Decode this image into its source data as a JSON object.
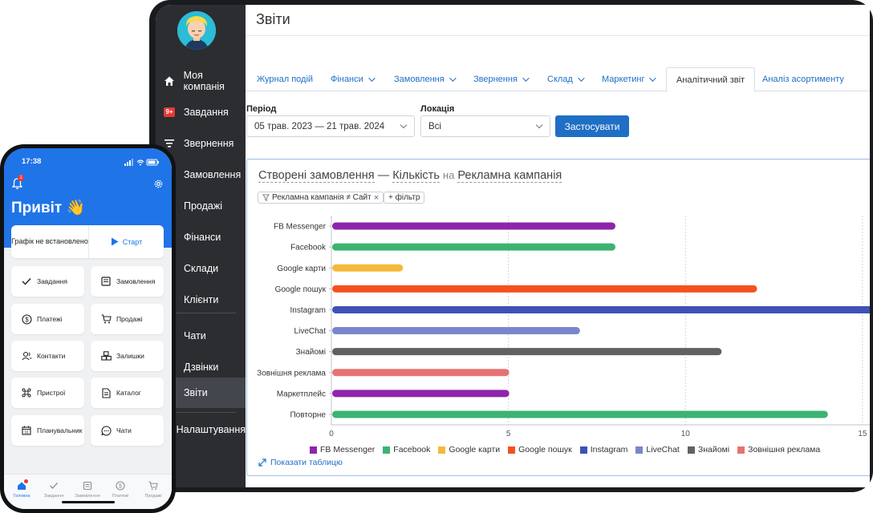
{
  "tablet": {
    "sidebar": {
      "items": [
        {
          "label": "Моя компанія",
          "icon": "home-icon"
        },
        {
          "label": "Завдання",
          "icon": "tasks-badge-icon",
          "badge": "9+"
        },
        {
          "label": "Звернення",
          "icon": "filter-icon"
        },
        {
          "label": "Замовлення",
          "icon": ""
        },
        {
          "label": "Продажі",
          "icon": ""
        },
        {
          "label": "Фінанси",
          "icon": ""
        },
        {
          "label": "Склади",
          "icon": ""
        },
        {
          "label": "Клієнти",
          "icon": ""
        },
        {
          "label": "Чати",
          "icon": ""
        },
        {
          "label": "Дзвінки",
          "icon": ""
        },
        {
          "label": "Звіти",
          "icon": "",
          "active": true
        },
        {
          "label": "Налаштування",
          "icon": ""
        }
      ]
    },
    "page_title": "Звіти",
    "tabs": [
      {
        "label": "Журнал подій",
        "dropdown": false
      },
      {
        "label": "Фінанси",
        "dropdown": true
      },
      {
        "label": "Замовлення",
        "dropdown": true
      },
      {
        "label": "Звернення",
        "dropdown": true
      },
      {
        "label": "Склад",
        "dropdown": true
      },
      {
        "label": "Маркетинг",
        "dropdown": true
      },
      {
        "label": "Аналітичний звіт",
        "dropdown": false,
        "active": true
      },
      {
        "label": "Аналіз асортименту",
        "dropdown": false
      }
    ],
    "filters": {
      "period_label": "Період",
      "period_value": "05 трав. 2023 — 21 трав. 2024",
      "location_label": "Локація",
      "location_value": "Всі",
      "apply_label": "Застосувати"
    },
    "report": {
      "title_metric": "Створені замовлення",
      "title_dash": "—",
      "title_measure": "Кількість",
      "title_on": "на",
      "title_dimension": "Рекламна кампанія",
      "filter_chip": "Рекламна кампанія ≠ Сайт",
      "add_filter": "+ фільтр",
      "show_table": "Показати таблицю"
    }
  },
  "chart_data": {
    "type": "bar",
    "orientation": "horizontal",
    "categories": [
      "FB Messenger",
      "Facebook",
      "Google карти",
      "Google пошук",
      "Instagram",
      "LiveChat",
      "Знайомі",
      "Зовнішня реклама",
      "Маркетплейс",
      "Повторне"
    ],
    "values": [
      8,
      8,
      2,
      12,
      16,
      7,
      11,
      5,
      5,
      14
    ],
    "colors": [
      "#8e24aa",
      "#3cb371",
      "#f5b93b",
      "#f4511e",
      "#3f51b5",
      "#7986cb",
      "#616161",
      "#e57373",
      "#8e24aa",
      "#3cb371"
    ],
    "x_ticks": [
      0,
      5,
      10,
      15
    ],
    "xlim": [
      0,
      15.75
    ],
    "grid": true,
    "legend": [
      {
        "name": "FB Messenger",
        "color": "#8e24aa"
      },
      {
        "name": "Facebook",
        "color": "#3cb371"
      },
      {
        "name": "Google карти",
        "color": "#f5b93b"
      },
      {
        "name": "Google пошук",
        "color": "#f4511e"
      },
      {
        "name": "Instagram",
        "color": "#3f51b5"
      },
      {
        "name": "LiveChat",
        "color": "#7986cb"
      },
      {
        "name": "Знайомі",
        "color": "#616161"
      },
      {
        "name": "Зовнішня реклама",
        "color": "#e57373"
      }
    ]
  },
  "phone": {
    "status_time": "17:38",
    "notification_badge": "1",
    "greeting": "Привіт 👋",
    "schedule_text": "Графік не встановлено",
    "start_label": "Старт",
    "tiles": [
      {
        "label": "Завдання",
        "icon": "check-icon"
      },
      {
        "label": "Замовлення",
        "icon": "orders-icon"
      },
      {
        "label": "Платежі",
        "icon": "dollar-icon"
      },
      {
        "label": "Продажі",
        "icon": "cart-icon"
      },
      {
        "label": "Контакти",
        "icon": "contacts-icon"
      },
      {
        "label": "Залишки",
        "icon": "boxes-icon"
      },
      {
        "label": "Пристрої",
        "icon": "command-icon"
      },
      {
        "label": "Каталог",
        "icon": "catalog-icon"
      },
      {
        "label": "Планувальник",
        "icon": "calendar-icon"
      },
      {
        "label": "Чати",
        "icon": "chat-icon"
      }
    ],
    "nav": [
      {
        "label": "Головна",
        "icon": "home-icon",
        "active": true
      },
      {
        "label": "Завдання",
        "icon": "check-icon"
      },
      {
        "label": "Замовлення",
        "icon": "orders-icon"
      },
      {
        "label": "Платежі",
        "icon": "dollar-icon"
      },
      {
        "label": "Продажі",
        "icon": "cart-icon"
      }
    ]
  }
}
